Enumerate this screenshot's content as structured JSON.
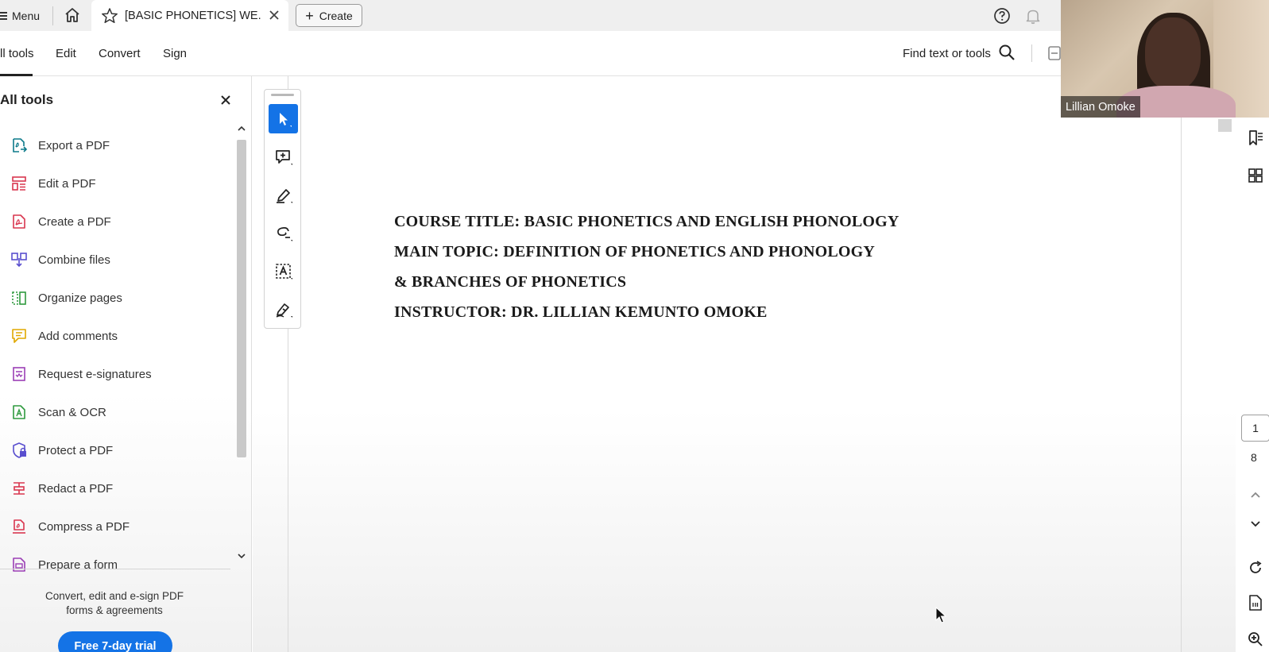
{
  "tabbar": {
    "menu_label": "Menu",
    "tab_title": "[BASIC PHONETICS] WE...",
    "create_label": "Create"
  },
  "menubar": {
    "all_tools": "ll tools",
    "edit": "Edit",
    "convert": "Convert",
    "sign": "Sign",
    "find": "Find text or tools"
  },
  "leftpanel": {
    "title": "All tools",
    "tools": [
      {
        "label": "Export a PDF",
        "icon": "export-pdf-icon",
        "color": "#0d7a8a"
      },
      {
        "label": "Edit a PDF",
        "icon": "edit-pdf-icon",
        "color": "#d9364f"
      },
      {
        "label": "Create a PDF",
        "icon": "create-pdf-icon",
        "color": "#d9364f"
      },
      {
        "label": "Combine files",
        "icon": "combine-files-icon",
        "color": "#5a4fcf"
      },
      {
        "label": "Organize pages",
        "icon": "organize-pages-icon",
        "color": "#2e9a3e"
      },
      {
        "label": "Add comments",
        "icon": "add-comments-icon",
        "color": "#e0a800"
      },
      {
        "label": "Request e-signatures",
        "icon": "request-esignatures-icon",
        "color": "#9b3fb5"
      },
      {
        "label": "Scan & OCR",
        "icon": "scan-ocr-icon",
        "color": "#2e9a3e"
      },
      {
        "label": "Protect a PDF",
        "icon": "protect-pdf-icon",
        "color": "#5a4fcf"
      },
      {
        "label": "Redact a PDF",
        "icon": "redact-pdf-icon",
        "color": "#d9364f"
      },
      {
        "label": "Compress a PDF",
        "icon": "compress-pdf-icon",
        "color": "#d9364f"
      },
      {
        "label": "Prepare a form",
        "icon": "prepare-form-icon",
        "color": "#9b3fb5"
      }
    ],
    "promo": "Convert, edit and e-sign PDF forms & agreements",
    "trial_label": "Free 7-day trial"
  },
  "document": {
    "line1": "COURSE TITLE: BASIC PHONETICS AND ENGLISH PHONOLOGY",
    "line2": "MAIN TOPIC: DEFINITION OF PHONETICS AND PHONOLOGY",
    "line3": "& BRANCHES OF PHONETICS",
    "line4": "INSTRUCTOR: DR. LILLIAN KEMUNTO OMOKE"
  },
  "pagenav": {
    "current": "1",
    "total": "8"
  },
  "video": {
    "name": "Lillian Omoke"
  },
  "colors": {
    "accent": "#1473e6"
  }
}
